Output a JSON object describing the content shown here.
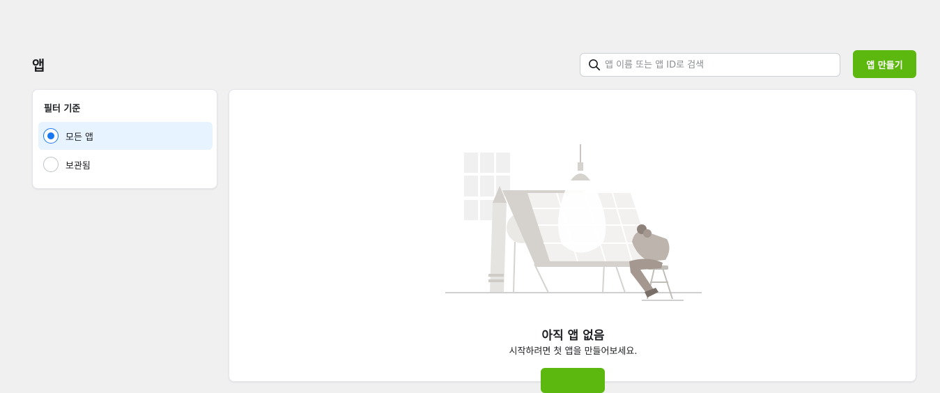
{
  "page": {
    "title": "앱"
  },
  "search": {
    "placeholder": "앱 이름 또는 앱 ID로 검색",
    "value": ""
  },
  "header": {
    "create_button_label": "앱 만들기"
  },
  "filter": {
    "title": "필터 기준",
    "options": [
      {
        "label": "모든 앱",
        "selected": true
      },
      {
        "label": "보관됨",
        "selected": false
      }
    ]
  },
  "empty_state": {
    "title": "아직 앱 없음",
    "subtitle": "시작하려면 첫 앱을 만들어보세요."
  },
  "colors": {
    "accent_green": "#5cb80e",
    "selected_blue": "#1877f2",
    "selected_bg": "#e7f3ff",
    "page_bg": "#f0f0f0"
  }
}
